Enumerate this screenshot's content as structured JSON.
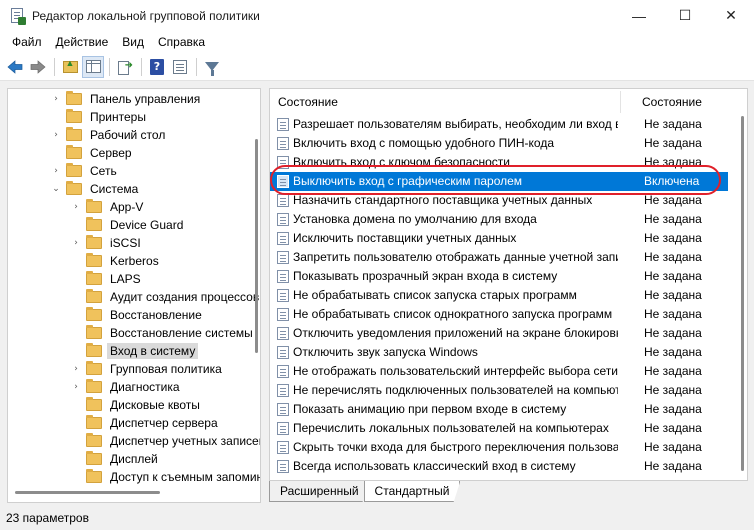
{
  "window": {
    "title": "Редактор локальной групповой политики",
    "minimize": "—",
    "maximize": "☐",
    "close": "✕"
  },
  "menu": [
    "Файл",
    "Действие",
    "Вид",
    "Справка"
  ],
  "toolbar": {
    "icons": [
      "back-arrow-icon",
      "forward-arrow-icon",
      "folder-up-icon",
      "show-hide-tree-icon",
      "export-list-icon",
      "help-icon",
      "properties-icon",
      "filter-icon"
    ],
    "help_glyph": "?"
  },
  "tree": [
    {
      "label": "Панель управления",
      "chevron": "›",
      "level": 0
    },
    {
      "label": "Принтеры",
      "chevron": "",
      "level": 0
    },
    {
      "label": "Рабочий стол",
      "chevron": "›",
      "level": 0
    },
    {
      "label": "Сервер",
      "chevron": "",
      "level": 0
    },
    {
      "label": "Сеть",
      "chevron": "›",
      "level": 0
    },
    {
      "label": "Система",
      "chevron": "⌄",
      "level": 0
    },
    {
      "label": "App-V",
      "chevron": "›",
      "level": 1
    },
    {
      "label": "Device Guard",
      "chevron": "",
      "level": 1
    },
    {
      "label": "iSCSI",
      "chevron": "›",
      "level": 1
    },
    {
      "label": "Kerberos",
      "chevron": "",
      "level": 1
    },
    {
      "label": "LAPS",
      "chevron": "",
      "level": 1
    },
    {
      "label": "Аудит создания процессов",
      "chevron": "",
      "level": 1
    },
    {
      "label": "Восстановление",
      "chevron": "",
      "level": 1
    },
    {
      "label": "Восстановление системы",
      "chevron": "",
      "level": 1
    },
    {
      "label": "Вход в систему",
      "chevron": "",
      "level": 1,
      "selected": true
    },
    {
      "label": "Групповая политика",
      "chevron": "›",
      "level": 1
    },
    {
      "label": "Диагностика",
      "chevron": "›",
      "level": 1
    },
    {
      "label": "Дисковые квоты",
      "chevron": "",
      "level": 1
    },
    {
      "label": "Диспетчер сервера",
      "chevron": "",
      "level": 1
    },
    {
      "label": "Диспетчер учетных записей",
      "chevron": "",
      "level": 1
    },
    {
      "label": "Дисплей",
      "chevron": "",
      "level": 1
    },
    {
      "label": "Доступ к съемным запоминающим",
      "chevron": "",
      "level": 1
    }
  ],
  "list": {
    "col_name": "Состояние",
    "col_state": "Состояние",
    "rows": [
      {
        "name": "Разрешает пользователям выбирать, необходим ли вход в систему",
        "state": "Не задана"
      },
      {
        "name": "Включить вход с помощью удобного ПИН-кода",
        "state": "Не задана"
      },
      {
        "name": "Включить вход с ключом безопасности",
        "state": "Не задана"
      },
      {
        "name": "Выключить вход с графическим паролем",
        "state": "Включена",
        "highlight": true
      },
      {
        "name": "Назначить стандартного поставщика учетных данных",
        "state": "Не задана"
      },
      {
        "name": "Установка домена по умолчанию для входа",
        "state": "Не задана"
      },
      {
        "name": "Исключить поставщики учетных данных",
        "state": "Не задана"
      },
      {
        "name": "Запретить пользователю отображать данные учетной записи",
        "state": "Не задана"
      },
      {
        "name": "Показывать прозрачный экран входа в систему",
        "state": "Не задана"
      },
      {
        "name": "Не обрабатывать список запуска старых программ",
        "state": "Не задана"
      },
      {
        "name": "Не обрабатывать список однократного запуска программ",
        "state": "Не задана"
      },
      {
        "name": "Отключить уведомления приложений на экране блокировки",
        "state": "Не задана"
      },
      {
        "name": "Отключить звук запуска Windows",
        "state": "Не задана"
      },
      {
        "name": "Не отображать пользовательский интерфейс выбора сети",
        "state": "Не задана"
      },
      {
        "name": "Не перечислять подключенных пользователей на компьютере",
        "state": "Не задана"
      },
      {
        "name": "Показать анимацию при первом входе в систему",
        "state": "Не задана"
      },
      {
        "name": "Перечислить локальных пользователей на компьютерах",
        "state": "Не задана"
      },
      {
        "name": "Скрыть точки входа для быстрого переключения пользователей",
        "state": "Не задана"
      },
      {
        "name": "Всегда использовать классический вход в систему",
        "state": "Не задана"
      }
    ]
  },
  "tabs": [
    "Расширенный",
    "Стандартный"
  ],
  "status": "23 параметров"
}
